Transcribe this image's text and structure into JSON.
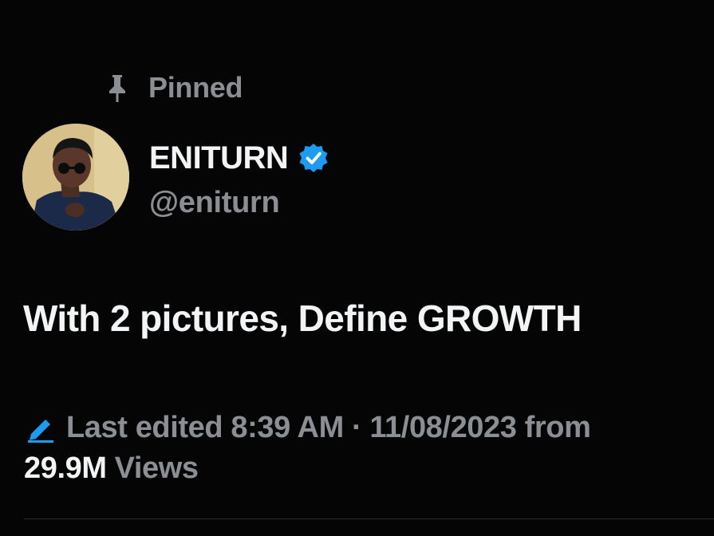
{
  "pinned": {
    "icon": "pin-icon",
    "label": "Pinned"
  },
  "author": {
    "avatar": "avatar",
    "display_name": "ENITURN",
    "verified_icon": "verified-badge-icon",
    "handle": "@eniturn"
  },
  "tweet": {
    "text": "With 2 pictures, Define GROWTH"
  },
  "meta": {
    "edit_icon": "pencil-icon",
    "edited_text": "Last edited 8:39 AM · 11/08/2023  from",
    "views_count": "29.9M",
    "views_label": "Views"
  },
  "colors": {
    "background": "#050505",
    "primary_text": "#f2f4f5",
    "secondary_text": "#8b8f94",
    "accent_blue": "#1d9bf0"
  }
}
